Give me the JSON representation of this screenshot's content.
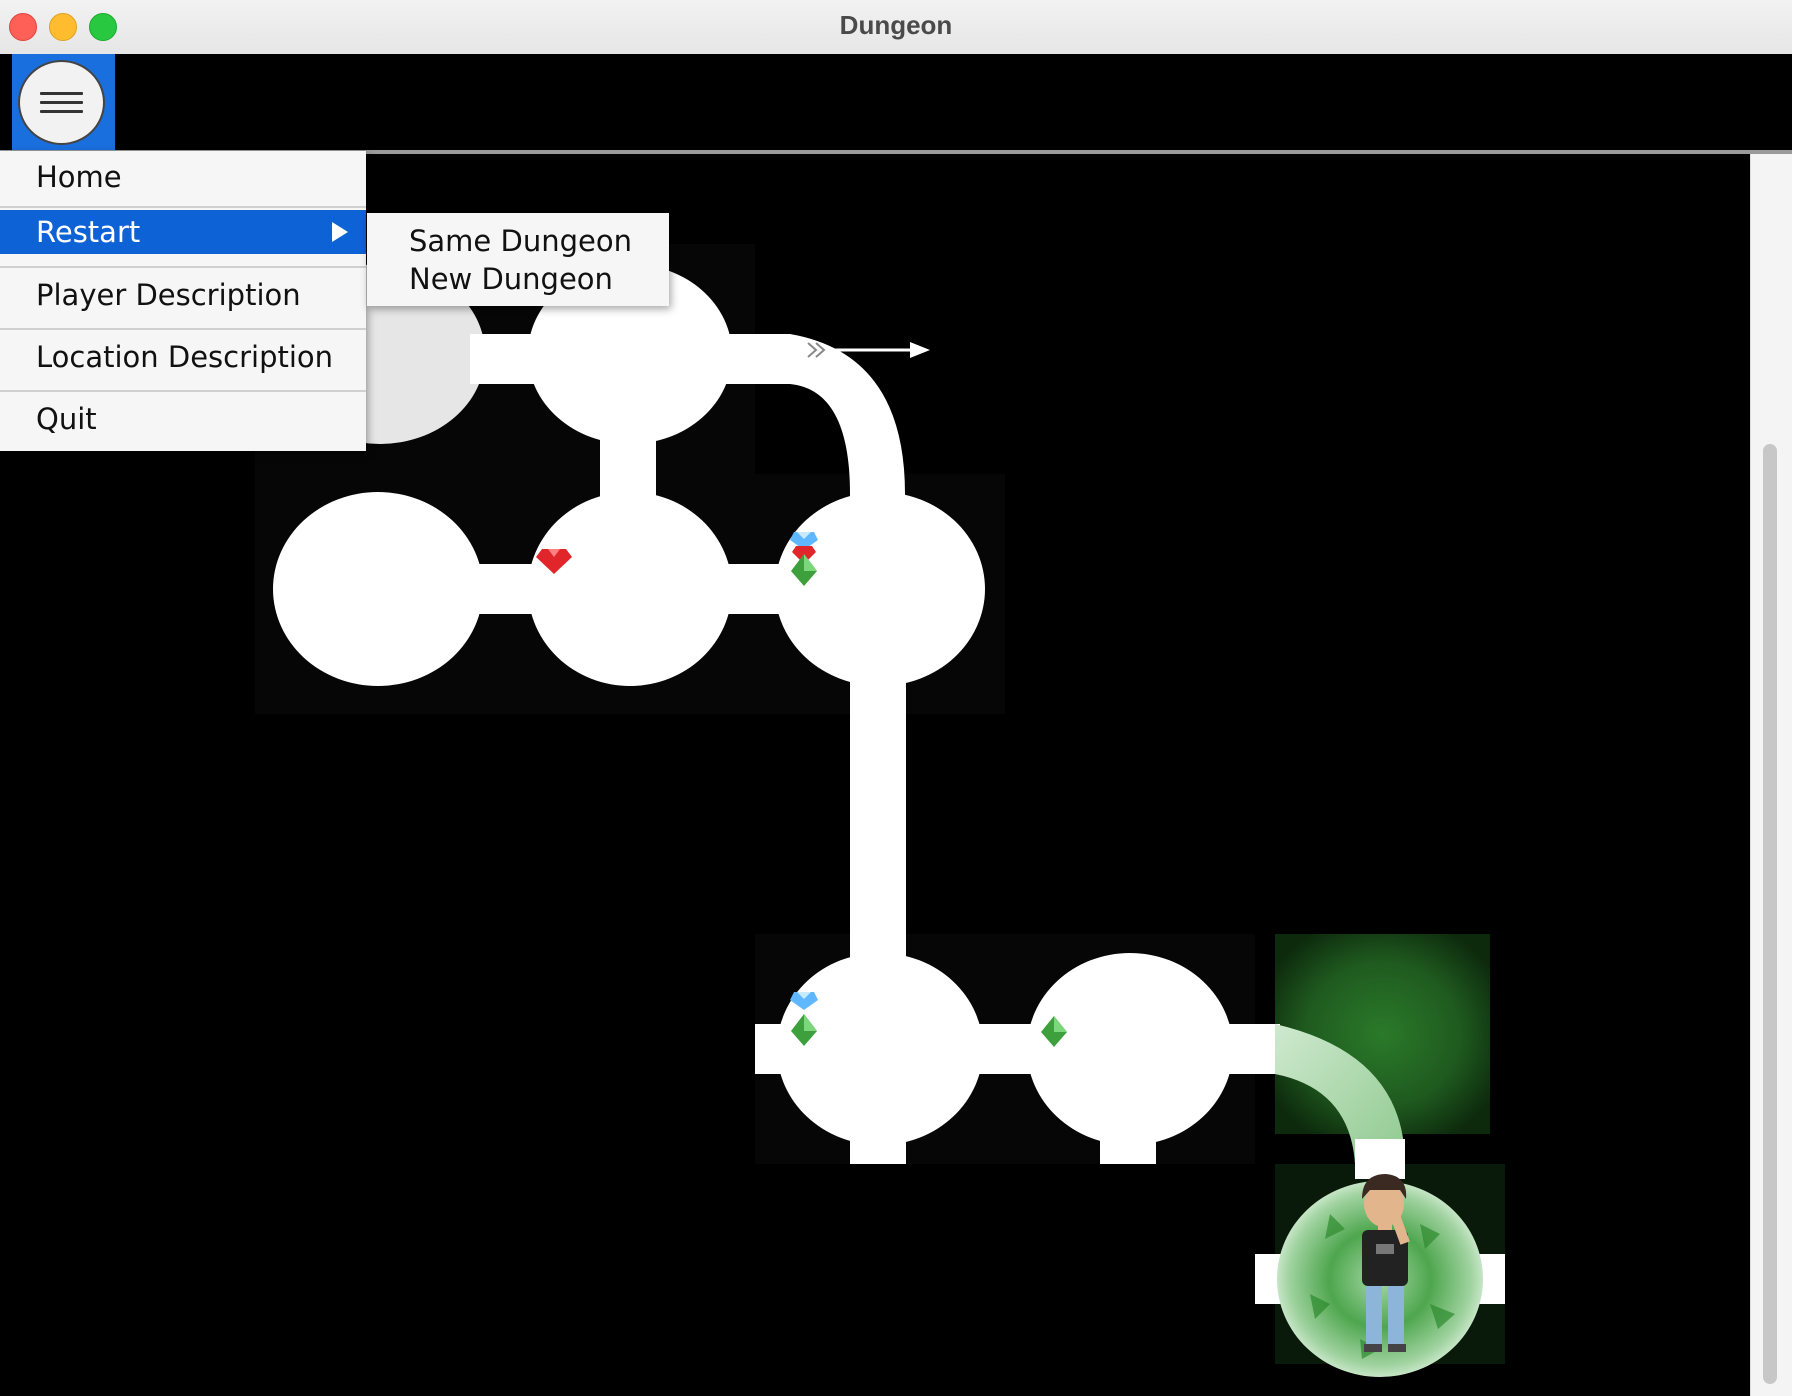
{
  "window": {
    "title": "Dungeon"
  },
  "menu": {
    "items": [
      {
        "label": "Home",
        "selected": false,
        "has_submenu": false
      },
      {
        "label": "Restart",
        "selected": true,
        "has_submenu": true
      },
      {
        "label": "Player Description",
        "selected": false,
        "has_submenu": false
      },
      {
        "label": "Location Description",
        "selected": false,
        "has_submenu": false
      },
      {
        "label": "Quit",
        "selected": false,
        "has_submenu": false
      }
    ],
    "submenu": [
      {
        "label": "Same Dungeon"
      },
      {
        "label": "New Dungeon"
      }
    ]
  },
  "map": {
    "background": "#000000",
    "cave_color": "#ffffff",
    "selected_color": "#0d62d6",
    "icons": [
      "hamburger-menu-icon",
      "arrow-icon",
      "ruby-icon",
      "diamond-icon",
      "emerald-icon",
      "otyugh-smell-icon",
      "player-avatar-icon"
    ]
  }
}
